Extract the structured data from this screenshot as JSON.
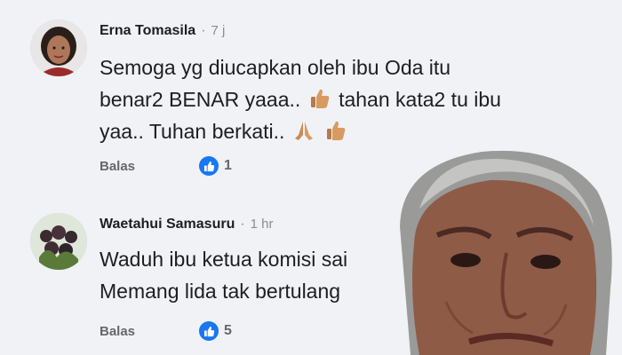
{
  "comments": [
    {
      "author": "Erna Tomasila",
      "time": "7 j",
      "line1": "Semoga yg diucapkan oleh ibu Oda itu",
      "line2a": "benar2 BENAR yaaa..",
      "line2b": "tahan kata2 tu ibu",
      "line3": "yaa.. Tuhan berkati..",
      "reply_label": "Balas",
      "like_count": "1"
    },
    {
      "author": "Waetahui Samasuru",
      "time": "1 hr",
      "line1": "Waduh ibu ketua komisi sai",
      "line2": "Memang lida tak bertulang",
      "reply_label": "Balas",
      "like_count": "5"
    }
  ],
  "icons": {
    "like": "thumbs-up-icon",
    "thumb": "thumbs-up-emoji",
    "pray": "praying-hands-emoji"
  },
  "colors": {
    "background": "#f0f2f5",
    "author_text": "#1c1e21",
    "meta_text": "#8a8d91",
    "action_text": "#65676b",
    "like_blue": "#1877f2"
  }
}
